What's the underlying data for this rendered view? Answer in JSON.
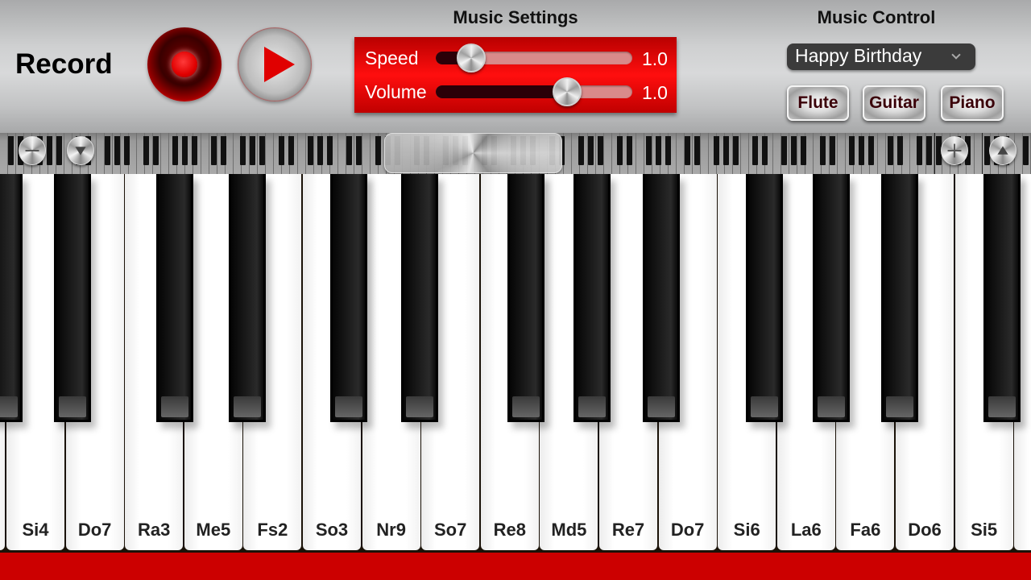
{
  "record": {
    "label": "Record",
    "record_button": "record-icon",
    "play_button": "play-icon"
  },
  "settings": {
    "title": "Music Settings",
    "speed": {
      "label": "Speed",
      "value_text": "1.0",
      "position": 0.18
    },
    "volume": {
      "label": "Volume",
      "value_text": "1.0",
      "position": 0.67
    }
  },
  "control": {
    "title": "Music Control",
    "song": "Happy Birthday",
    "instruments": [
      "Flute",
      "Guitar",
      "Piano"
    ]
  },
  "navigator": {
    "zoom_out_icon": "minus-icon",
    "scroll_down_icon": "triangle-down-icon",
    "zoom_in_icon": "plus-icon",
    "scroll_up_icon": "triangle-up-icon",
    "view_position": 0.45
  },
  "keys": {
    "white": [
      "Si4",
      "Do7",
      "Ra3",
      "Me5",
      "Fs2",
      "So3",
      "Nr9",
      "So7",
      "Re8",
      "Md5",
      "Re7",
      "Do7",
      "Si6",
      "La6",
      "Fa6",
      "Do6",
      "Si5",
      ""
    ]
  },
  "colors": {
    "accent_red": "#cc0000",
    "panel_red": "#ff0e0e",
    "label_dark_red": "#3a0008"
  }
}
